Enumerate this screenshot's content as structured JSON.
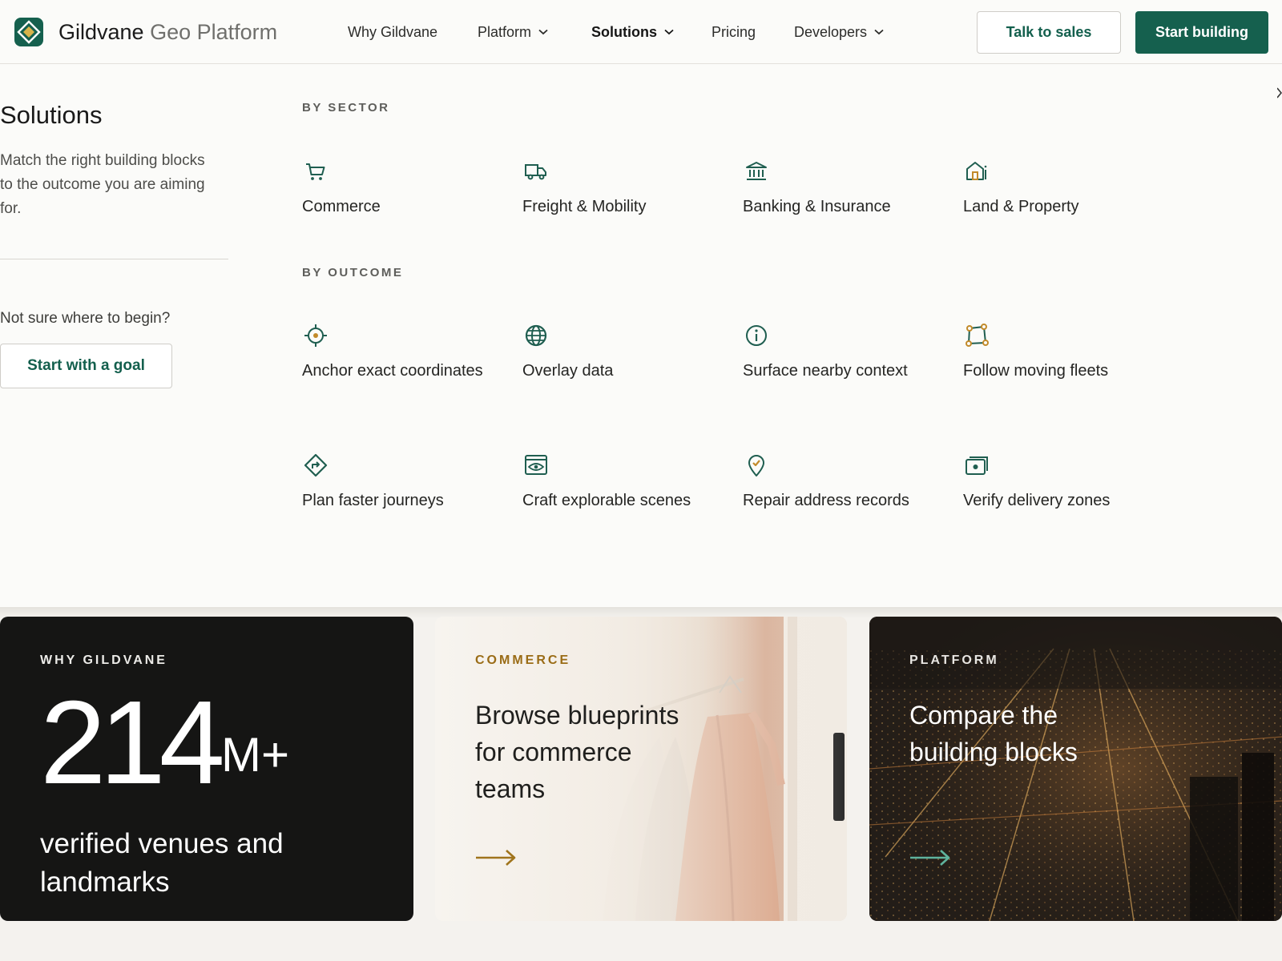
{
  "header": {
    "brand_primary": "Gildvane",
    "brand_secondary": "Geo Platform",
    "nav": [
      {
        "label": "Why Gildvane",
        "has_dropdown": false,
        "active": false
      },
      {
        "label": "Platform",
        "has_dropdown": true,
        "active": false
      },
      {
        "label": "Solutions",
        "has_dropdown": true,
        "active": true
      },
      {
        "label": "Pricing",
        "has_dropdown": false,
        "active": false
      },
      {
        "label": "Developers",
        "has_dropdown": true,
        "active": false
      }
    ],
    "talk_to_sales": "Talk to sales",
    "start_building": "Start building"
  },
  "menu": {
    "title": "Solutions",
    "description": "Match the right building blocks to the outcome you are aiming for.",
    "help_question": "Not sure where to begin?",
    "goal_button": "Start with a goal",
    "by_sector": {
      "label": "BY SECTOR",
      "items": [
        {
          "label": "Commerce",
          "icon": "cart-icon"
        },
        {
          "label": "Freight & Mobility",
          "icon": "truck-icon"
        },
        {
          "label": "Banking & Insurance",
          "icon": "bank-icon"
        },
        {
          "label": "Land & Property",
          "icon": "house-icon"
        }
      ]
    },
    "by_outcome": {
      "label": "BY OUTCOME",
      "items": [
        {
          "label": "Anchor exact coordinates",
          "icon": "crosshair-icon"
        },
        {
          "label": "Overlay data",
          "icon": "globe-icon"
        },
        {
          "label": "Surface nearby context",
          "icon": "info-icon"
        },
        {
          "label": "Follow moving fleets",
          "icon": "route-nodes-icon"
        },
        {
          "label": "Plan faster journeys",
          "icon": "directions-icon"
        },
        {
          "label": "Craft explorable scenes",
          "icon": "eye-screen-icon"
        },
        {
          "label": "Repair address records",
          "icon": "pin-check-icon"
        },
        {
          "label": "Verify delivery zones",
          "icon": "camera-screen-icon"
        }
      ]
    }
  },
  "cards": [
    {
      "eyebrow": "WHY GILDVANE",
      "number": "214",
      "suffix": "M+",
      "description": "verified venues and landmarks"
    },
    {
      "eyebrow": "COMMERCE",
      "headline": "Browse blueprints for commerce teams",
      "arrow_color": "#a0741c"
    },
    {
      "eyebrow": "PLATFORM",
      "headline": "Compare the building blocks",
      "arrow_color": "#5fb39d"
    }
  ],
  "colors": {
    "brand_green": "#15604e",
    "accent_gold": "#a0741c",
    "accent_teal": "#5fb39d"
  }
}
